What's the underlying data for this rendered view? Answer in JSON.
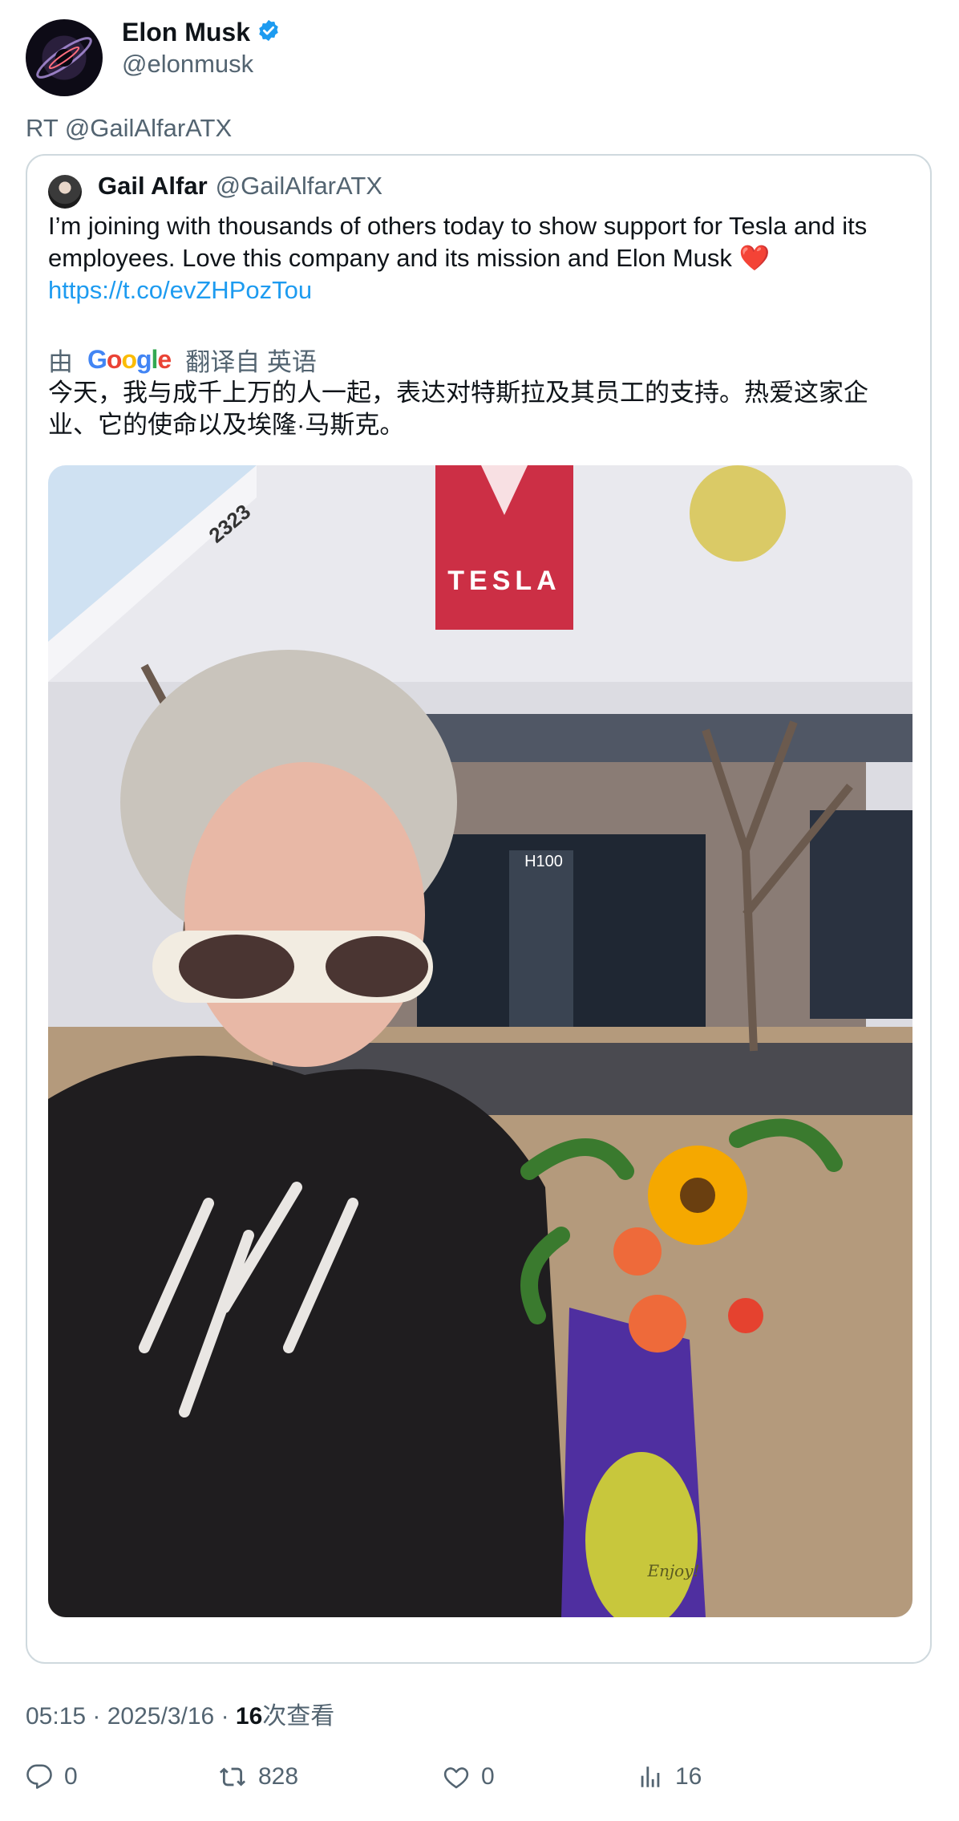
{
  "author": {
    "name": "Elon Musk",
    "handle": "@elonmusk",
    "verified_icon": "verified-badge-icon",
    "verified_color": "#1d9bf0"
  },
  "retweet_line": "RT @GailAlfarATX",
  "quoted": {
    "name": "Gail Alfar",
    "handle": "@GailAlfarATX",
    "text_lines": [
      "I’m joining with thousands of others today to show support for Tesla and its",
      "employees. Love this company and its mission and Elon Musk ❤️"
    ],
    "link": "https://t.co/evZHPozTou",
    "translation": {
      "prefix": "由",
      "provider": "Google",
      "suffix": "翻译自 英语",
      "text_lines": [
        "今天，我与成千上万的人一起，表达对特斯拉及其员工的支持。热爱这家企",
        "业、它的使命以及埃隆·马斯克。"
      ]
    },
    "photo": {
      "sign_text": "TESLA",
      "suite_text": "H100",
      "building_number": "2323",
      "card_word": "Enjoy!"
    }
  },
  "meta": {
    "time": "05:15",
    "date": "2025/3/16",
    "views_count": "16",
    "views_label": "次查看"
  },
  "actions": {
    "reply": {
      "icon": "reply-icon",
      "count": "0"
    },
    "retweet": {
      "icon": "retweet-icon",
      "count": "828"
    },
    "like": {
      "icon": "heart-icon",
      "count": "0"
    },
    "views": {
      "icon": "views-chart-icon",
      "count": "16"
    }
  },
  "colors": {
    "link": "#1d9bf0",
    "secondary_text": "#536471",
    "border": "#cfd9de"
  }
}
